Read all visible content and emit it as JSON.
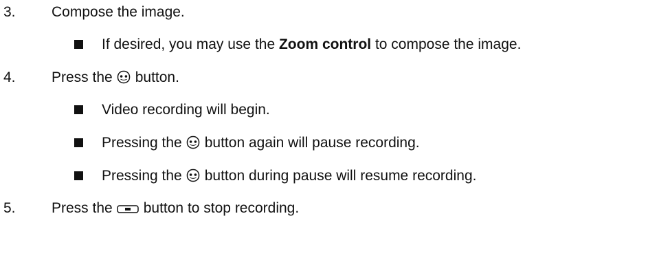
{
  "steps": [
    {
      "num": "3.",
      "text": "Compose the image."
    },
    {
      "num": "4.",
      "before": "Press the",
      "after": "button.",
      "icon": "record-button-icon"
    },
    {
      "num": "5.",
      "before": "Press the",
      "after": "button to stop recording.",
      "icon": "stop-button-icon"
    }
  ],
  "bullets": [
    {
      "before": "If desired, you may use the ",
      "bold": "Zoom control",
      "after": " to compose the image."
    },
    {
      "text": "Video recording will begin."
    },
    {
      "before": "Pressing the",
      "after": "button again will pause recording.",
      "icon": "record-button-icon"
    },
    {
      "before": "Pressing the",
      "after": "button during pause will resume recording.",
      "icon": "record-button-icon"
    }
  ]
}
